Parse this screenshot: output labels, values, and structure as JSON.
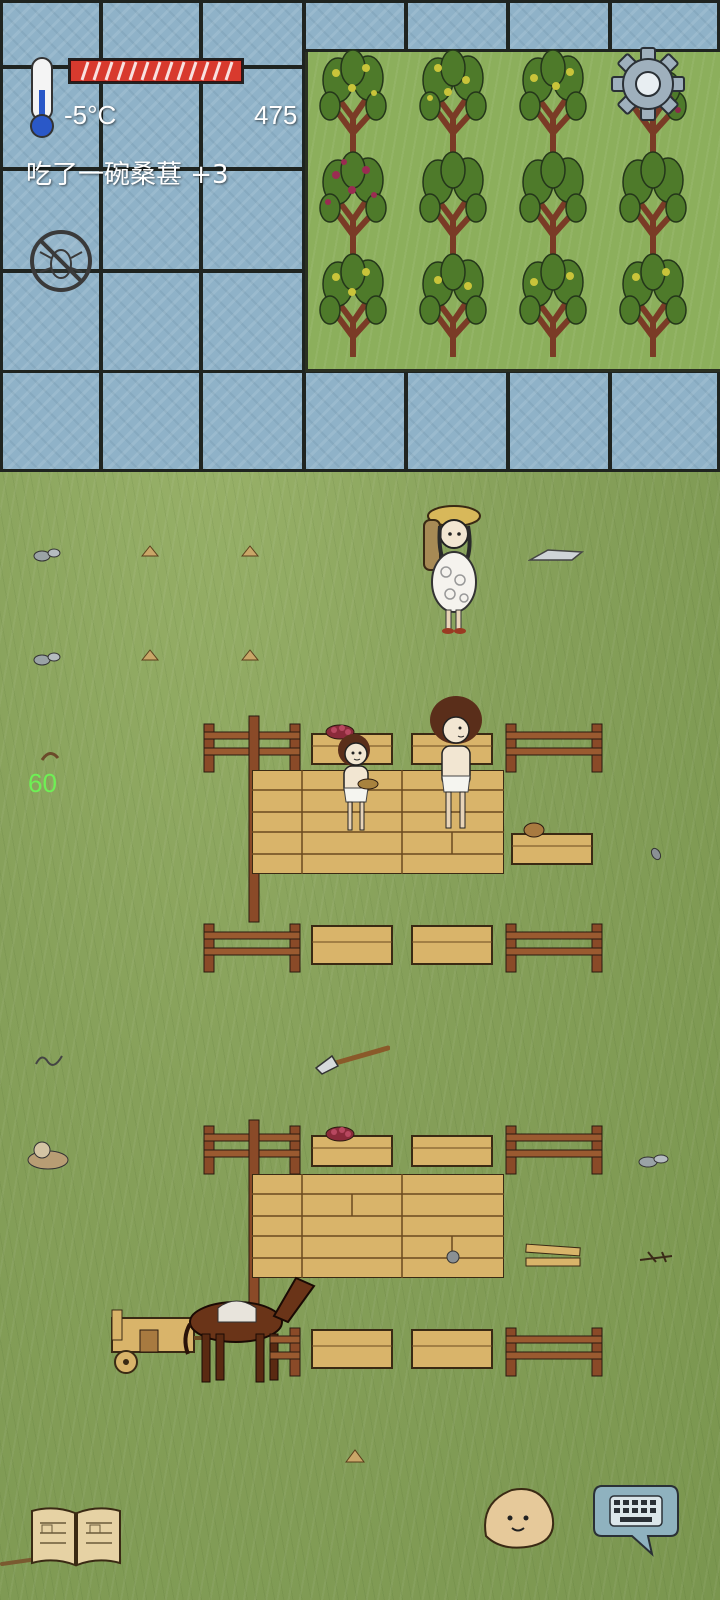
{
  "hud": {
    "temperature": "-5°C",
    "score": "475",
    "message": "吃了一碗桑葚 +3",
    "age": "60",
    "health_fraction": 1.0
  },
  "icons": {
    "thermometer": "thermometer-icon",
    "health": "health-bar",
    "settings": "gear-icon",
    "no_bugs": "no-bugs-icon",
    "book": "recipe-book-icon",
    "emote": "emote-face-icon",
    "keyboard": "keyboard-chat-icon"
  },
  "colors": {
    "water": "#8fb2c8",
    "grass": "#86a05a",
    "health_red": "#d83a2e",
    "age_green": "#6ef055",
    "wood": "#d9b46a"
  }
}
